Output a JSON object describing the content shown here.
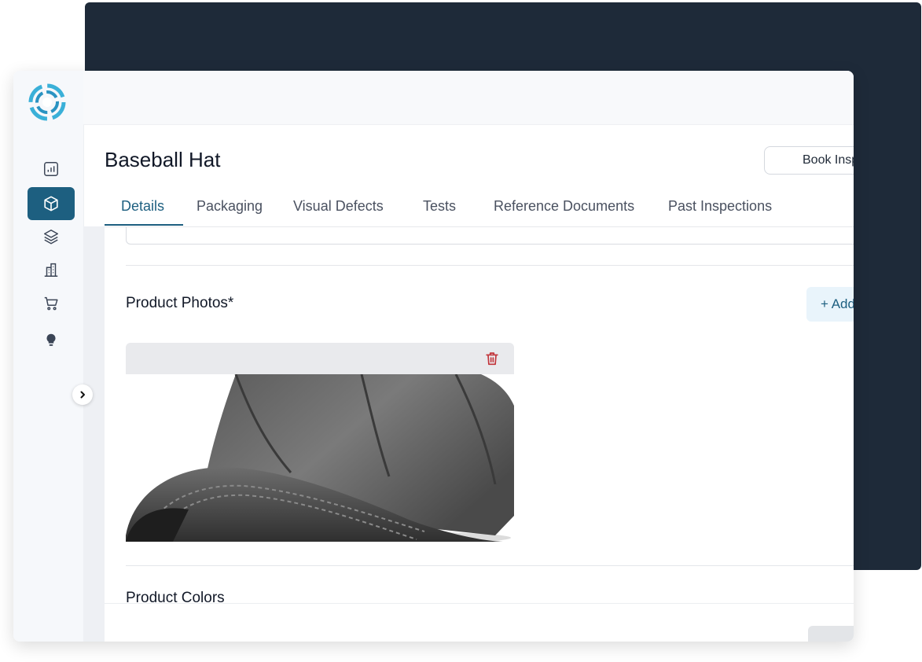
{
  "page": {
    "title": "Baseball Hat",
    "book_button_label": "Book Inspection"
  },
  "tabs": [
    {
      "label": "Details",
      "active": true
    },
    {
      "label": "Packaging",
      "active": false
    },
    {
      "label": "Visual Defects",
      "active": false
    },
    {
      "label": "Tests",
      "active": false
    },
    {
      "label": "Reference Documents",
      "active": false
    },
    {
      "label": "Past Inspections",
      "active": false
    }
  ],
  "sidebar": {
    "items": [
      {
        "icon": "analytics-icon",
        "active": false
      },
      {
        "icon": "product-box-icon",
        "active": true
      },
      {
        "icon": "layers-icon",
        "active": false
      },
      {
        "icon": "building-icon",
        "active": false
      },
      {
        "icon": "shopping-cart-icon",
        "active": false
      },
      {
        "icon": "lightbulb-icon",
        "active": false
      }
    ],
    "expand_icon": "chevron-right-icon"
  },
  "sections": {
    "photos_label": "Product Photos*",
    "add_button_label": "+ Add",
    "colors_label": "Product Colors"
  },
  "colors": {
    "accent": "#1d5f80",
    "backdrop": "#1e2a39",
    "delete": "#c2343a"
  }
}
